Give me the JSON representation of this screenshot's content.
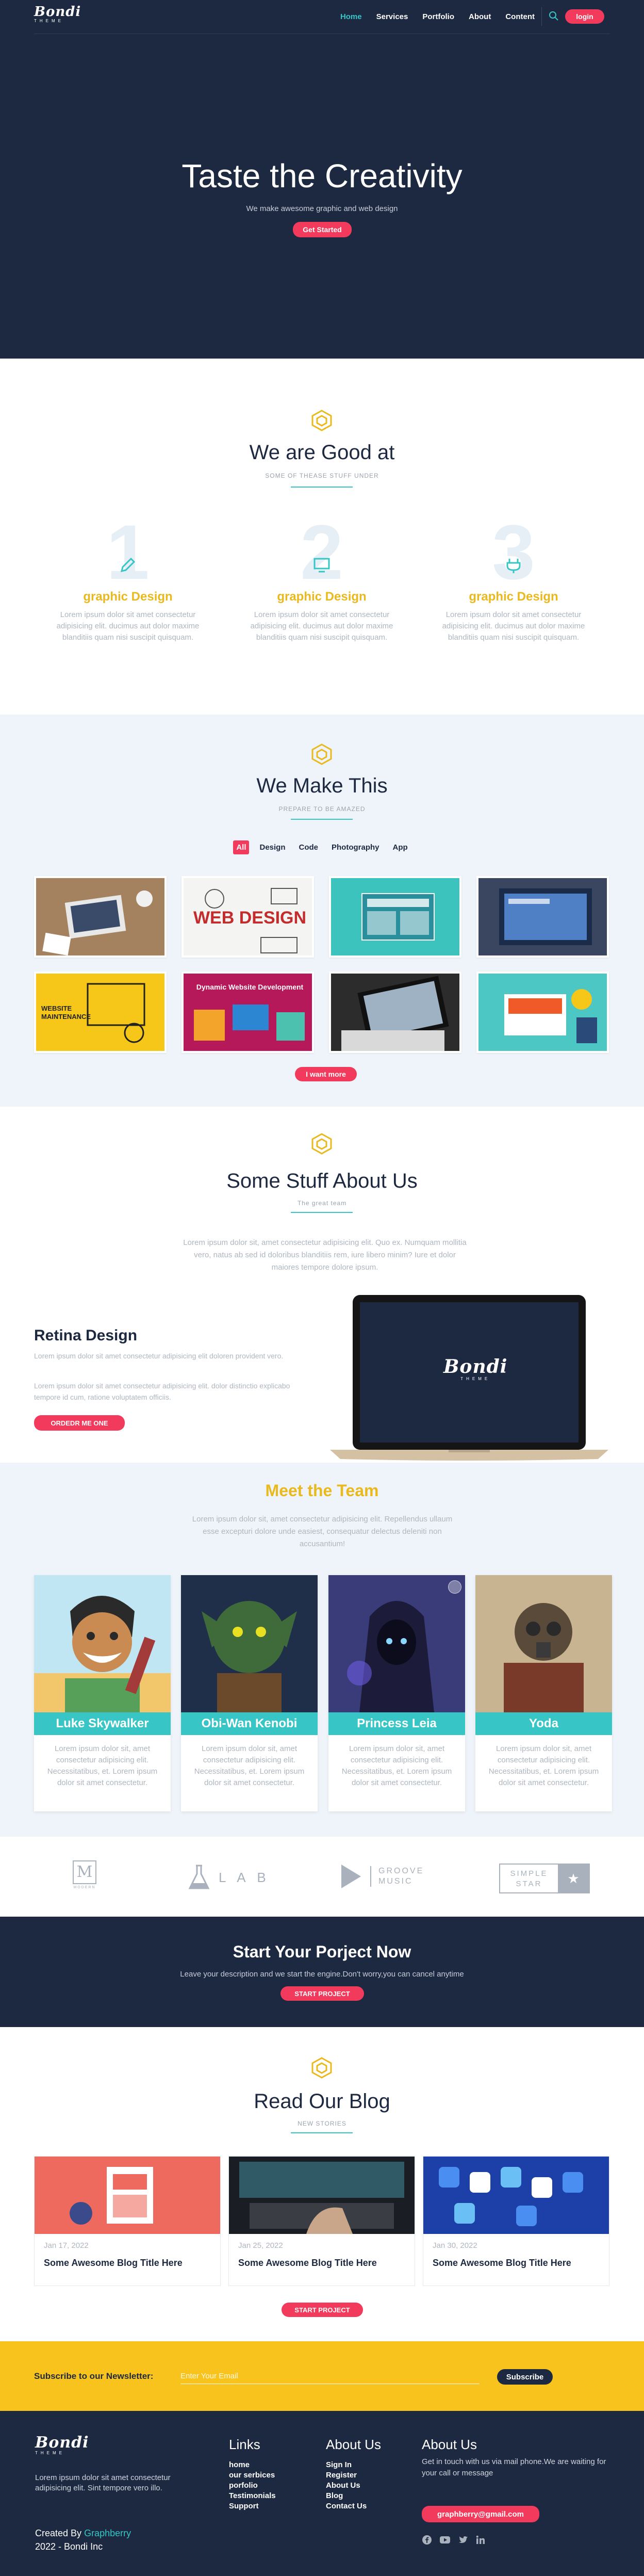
{
  "colors": {
    "navy": "#1d2841",
    "teal": "#37c5c5",
    "pink": "#f23a5c",
    "yellow": "#e9b91d",
    "newsletter_bg": "#f8c31c"
  },
  "brand": {
    "logo": "Bondi",
    "logo_sub": "THEME"
  },
  "nav": {
    "links": [
      "Home",
      "Services",
      "Portfolio",
      "About",
      "Content"
    ],
    "active": "Home",
    "search_icon": "search-icon",
    "login": "login"
  },
  "hero": {
    "title": "Taste the Creativity",
    "subtitle": "We make awesome graphic and web design",
    "button": "Get Started"
  },
  "good": {
    "title": "We are Good at",
    "subtitle": "SOME OF THEASE STUFF UNDER",
    "skills": [
      {
        "num": "1",
        "icon": "pencil-icon",
        "title": "graphic Design",
        "text": "Lorem ipsum dolor sit amet consectetur adipisicing elit. ducimus aut dolor maxime blanditiis quam nisi suscipit quisquam."
      },
      {
        "num": "2",
        "icon": "monitor-icon",
        "title": "graphic Design",
        "text": "Lorem ipsum dolor sit amet consectetur adipisicing elit. ducimus aut dolor maxime blanditiis quam nisi suscipit quisquam."
      },
      {
        "num": "3",
        "icon": "plug-icon",
        "title": "graphic Design",
        "text": "Lorem ipsum dolor sit amet consectetur adipisicing elit. ducimus aut dolor maxime blanditiis quam nisi suscipit quisquam."
      }
    ]
  },
  "work": {
    "title": "We Make This",
    "subtitle": "PREPARE TO BE AMAZED",
    "filters": [
      "All",
      "Design",
      "Code",
      "Photography",
      "App"
    ],
    "active_filter": "All",
    "tiles": [
      "WEB DESIGN",
      "WEBSITE MAINTENANCE",
      "Dynamic Website Development"
    ],
    "button": "I want more"
  },
  "about": {
    "title": "Some Stuff About Us",
    "subtitle": "The great team",
    "description": "Lorem ipsum dolor sit, amet consectetur adipisicing elit. Quo ex. Numquam mollitia vero, natus ab sed id doloribus blanditiis rem, iure libero minim? Iure et dolor maiores tempore dolore ipsum.",
    "heading": "Retina Design",
    "para1": "Lorem ipsum dolor sit amet consectetur adipisicing elit doloren provident vero.",
    "para2": "Lorem ipsum dolor sit amet consectetur adipisicing elit. dolor distinctio explicabo tempore id cum, ratione voluptatem officiis.",
    "button": "ORDEDR ME ONE",
    "screen_logo": "Bondi",
    "screen_logo_sub": "THEME"
  },
  "team": {
    "title": "Meet the Team",
    "description": "Lorem ipsum dolor sit, amet consectetur adipisicing elit. Repellendus ullaum esse excepturi dolore unde easiest, consequatur delectus deleniti non accusantium!",
    "members": [
      {
        "name": "Luke Skywalker",
        "bio": "Lorem ipsum dolor sit, amet consectetur adipisicing elit. Necessitatibus, et. Lorem ipsum dolor sit amet consectetur."
      },
      {
        "name": "Obi-Wan Kenobi",
        "bio": "Lorem ipsum dolor sit, amet consectetur adipisicing elit. Necessitatibus, et. Lorem ipsum dolor sit amet consectetur."
      },
      {
        "name": "Princess Leia",
        "bio": "Lorem ipsum dolor sit, amet consectetur adipisicing elit. Necessitatibus, et. Lorem ipsum dolor sit amet consectetur."
      },
      {
        "name": "Yoda",
        "bio": "Lorem ipsum dolor sit, amet consectetur adipisicing elit. Necessitatibus, et. Lorem ipsum dolor sit amet consectetur."
      }
    ]
  },
  "clients": {
    "m_letter": "M",
    "m_sub": "MODERN",
    "lab": "L A B",
    "groove_1": "GROOVE",
    "groove_2": "MUSIC",
    "simple_1": "SIMPLE",
    "simple_2": "STAR",
    "star": "★"
  },
  "cta": {
    "title": "Start Your Porject Now",
    "subtitle": "Leave your description and we start the engine.Don't worry,you can cancel anytime",
    "button": "START PROJECT"
  },
  "blog": {
    "title": "Read Our Blog",
    "subtitle": "NEW STORIES",
    "posts": [
      {
        "date": "Jan 17, 2022",
        "title": "Some Awesome Blog Title Here"
      },
      {
        "date": "Jan 25, 2022",
        "title": "Some Awesome Blog Title Here"
      },
      {
        "date": "Jan 30, 2022",
        "title": "Some Awesome Blog Title Here"
      }
    ],
    "button": "START PROJECT"
  },
  "newsletter": {
    "label": "Subscribe to our Newsletter:",
    "placeholder": "Enter Your Email",
    "button": "Subscribe"
  },
  "footer": {
    "about": "Lorem ipsum dolor sit amet consectetur adipisicing elit. Sint tempore vero illo.",
    "created_by": "Created By",
    "author": "Graphberry",
    "copyright": "2022 - Bondi Inc",
    "links_title": "Links",
    "links": [
      "home",
      "our serbices",
      "porfolio",
      "Testimonials",
      "Support"
    ],
    "about_title": "About Us",
    "about_links": [
      "Sign In",
      "Register",
      "About Us",
      "Blog",
      "Contact Us"
    ],
    "contact_title": "About Us",
    "contact_text": "Get in touch with us via mail phone.We are waiting for your call or message",
    "email": "graphberry@gmail.com",
    "social_icons": [
      "facebook-icon",
      "youtube-icon",
      "twitter-icon",
      "linkedin-icon"
    ]
  }
}
